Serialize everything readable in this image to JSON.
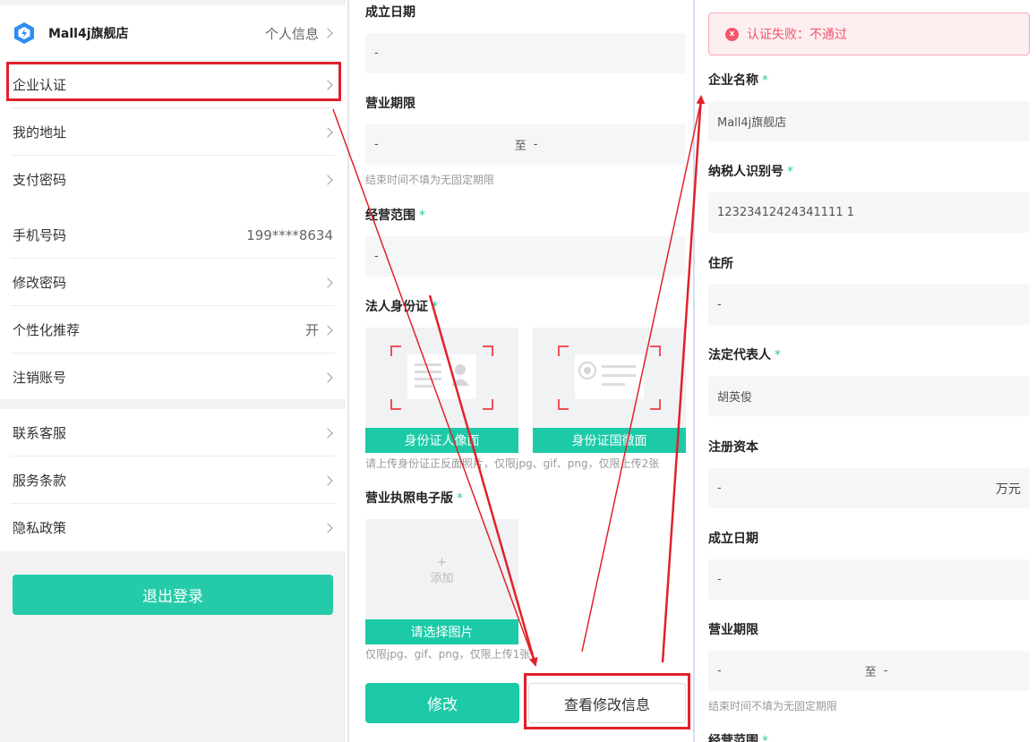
{
  "left": {
    "store_name": "Mall4j旗舰店",
    "personal_info": "个人信息",
    "menu1": [
      "企业认证",
      "我的地址",
      "支付密码"
    ],
    "phone_label": "手机号码",
    "phone_value": "199****8634",
    "change_pwd": "修改密码",
    "personalized": "个性化推荐",
    "personalized_value": "开",
    "cancel_account": "注销账号",
    "menu3": [
      "联系客服",
      "服务条款",
      "隐私政策"
    ],
    "logout": "退出登录"
  },
  "middle": {
    "established_label": "成立日期",
    "established_value": "-",
    "term_label": "营业期限",
    "term_from": "-",
    "term_to_sep": "至",
    "term_to": "-",
    "term_hint": "结束时间不填为无固定期限",
    "scope_label": "经营范围",
    "scope_value": "-",
    "required_mark": "*",
    "idcard_label": "法人身份证",
    "id_front": "身份证人像面",
    "id_back": "身份证国徽面",
    "id_hint": "请上传身份证正反面照片，仅限jpg、gif、png，仅限上传2张",
    "license_label": "营业执照电子版",
    "plus": "+",
    "add": "添加",
    "choose_image": "请选择图片",
    "license_hint": "仅限jpg、gif、png，仅限上传1张",
    "modify_button": "修改",
    "view_button": "查看修改信息"
  },
  "right": {
    "alert_icon": "x",
    "alert_text": "认证失败：不通过",
    "company_label": "企业名称",
    "company_value": "Mall4j旗舰店",
    "tax_label": "纳税人识别号",
    "tax_value": "12323412424341111 1",
    "address_label": "住所",
    "address_value": "-",
    "legal_label": "法定代表人",
    "legal_value": "胡英俊",
    "capital_label": "注册资本",
    "capital_value": "-",
    "capital_unit": "万元",
    "established_label": "成立日期",
    "established_value": "-",
    "term_label": "营业期限",
    "term_from": "-",
    "term_to_sep": "至",
    "term_to": "-",
    "term_hint": "结束时间不填为无固定期限",
    "scope_label": "经营范围"
  },
  "colors": {
    "accent": "#1ccaa7",
    "highlight": "#e1212a",
    "error": "#f1566c"
  }
}
